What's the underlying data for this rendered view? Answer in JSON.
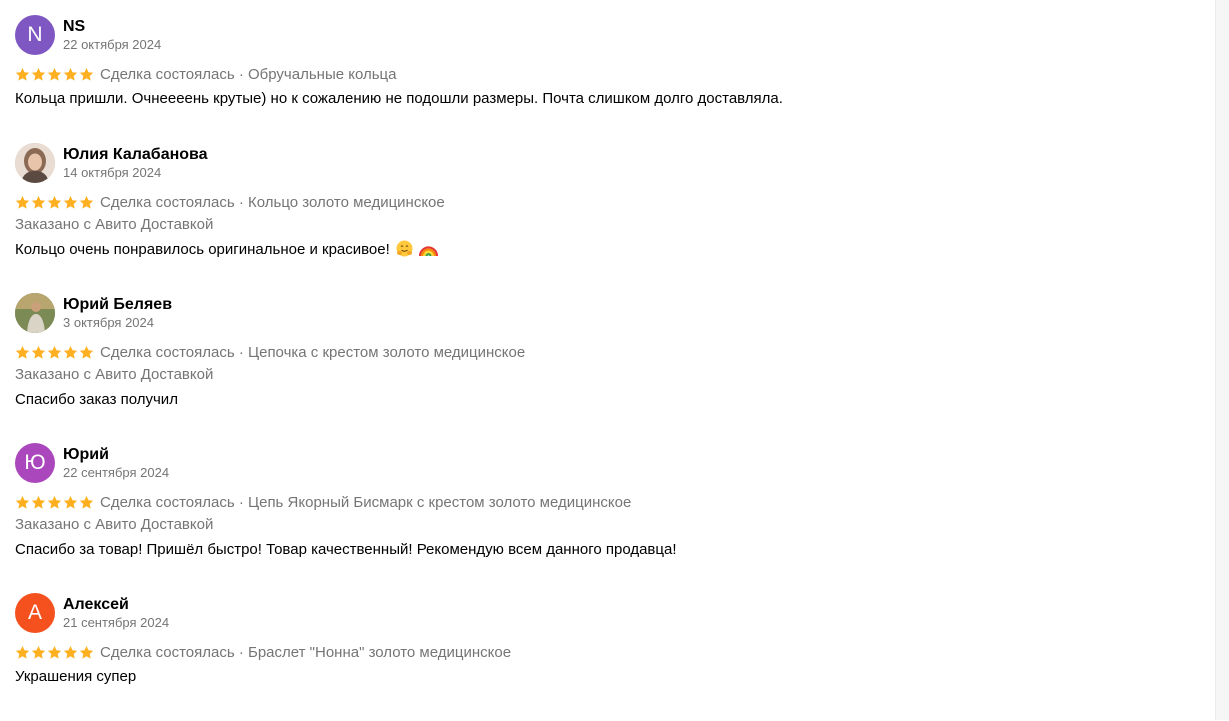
{
  "rating_star_color": "#FFB021",
  "reviews": [
    {
      "author": "NS",
      "initial": "N",
      "avatar_color": "#7E57C2",
      "avatar_type": "initial",
      "date": "22 октября 2024",
      "rating": 5,
      "meta": "Сделка состоялась · Обручальные кольца",
      "delivery": "",
      "text": "Кольца пришли. Очнеееень крутые) но к сожалению не подошли размеры. Почта слишком долго доставляла."
    },
    {
      "author": "Юлия Калабанова",
      "initial": "",
      "avatar_color": "#C9A88E",
      "avatar_type": "photo",
      "date": "14 октября 2024",
      "rating": 5,
      "meta": "Сделка состоялась · Кольцо золото медицинское",
      "delivery": "Заказано с Авито Доставкой",
      "text": "Кольцо очень понравилось оригинальное и красивое!",
      "emojis": [
        "hugging-face-emoji",
        "rainbow-emoji"
      ]
    },
    {
      "author": "Юрий Беляев",
      "initial": "",
      "avatar_color": "#6B7A4F",
      "avatar_type": "photo",
      "date": "3 октября 2024",
      "rating": 5,
      "meta": "Сделка состоялась · Цепочка с крестом золото медицинское",
      "delivery": "Заказано с Авито Доставкой",
      "text": "Спасибо заказ получил"
    },
    {
      "author": "Юрий",
      "initial": "Ю",
      "avatar_color": "#AB47BC",
      "avatar_type": "initial",
      "date": "22 сентября 2024",
      "rating": 5,
      "meta": "Сделка состоялась · Цепь Якорный Бисмарк с крестом золото медицинское",
      "delivery": "Заказано с Авито Доставкой",
      "text": "Спасибо за товар! Пришёл быстро! Товар качественный! Рекомендую всем данного продавца!"
    },
    {
      "author": "Алексей",
      "initial": "А",
      "avatar_color": "#F4511E",
      "avatar_type": "initial",
      "date": "21 сентября 2024",
      "rating": 5,
      "meta": "Сделка состоялась · Браслет \"Нонна\" золото медицинское",
      "delivery": "",
      "text": "Украшения супер"
    }
  ]
}
